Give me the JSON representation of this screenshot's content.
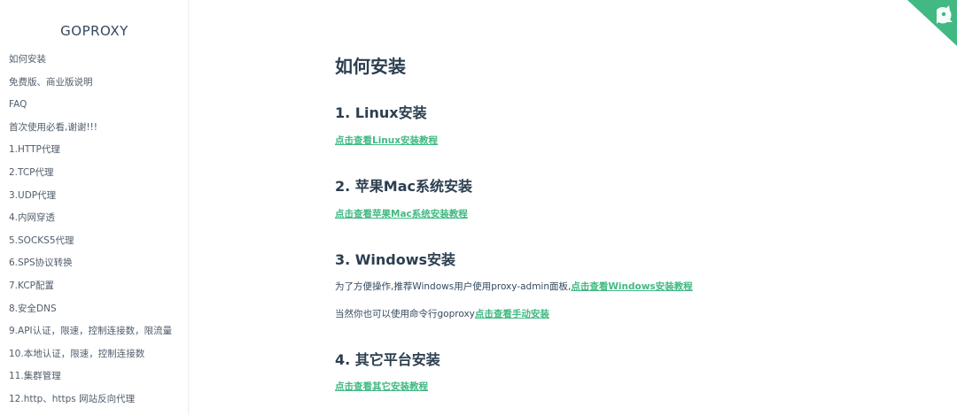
{
  "sidebar": {
    "app_name": "GOPROXY",
    "items": [
      {
        "label": "如何安装"
      },
      {
        "label": "免费版、商业版说明"
      },
      {
        "label": "FAQ"
      },
      {
        "label": "首次使用必看,谢谢!!!"
      },
      {
        "label": "1.HTTP代理"
      },
      {
        "label": "2.TCP代理"
      },
      {
        "label": "3.UDP代理"
      },
      {
        "label": "4.内网穿透"
      },
      {
        "label": "5.SOCKS5代理"
      },
      {
        "label": "6.SPS协议转换"
      },
      {
        "label": "7.KCP配置"
      },
      {
        "label": "8.安全DNS"
      },
      {
        "label": "9.API认证，限速，控制连接数，限流量"
      },
      {
        "label": "10.本地认证，限速，控制连接数"
      },
      {
        "label": "11.集群管理"
      },
      {
        "label": "12.http、https 网站反向代理"
      }
    ]
  },
  "main": {
    "title": "如何安装",
    "sections": [
      {
        "heading": "1. Linux安装",
        "link": "点击查看Linux安装教程"
      },
      {
        "heading": "2. 苹果Mac系统安装",
        "link": "点击查看苹果Mac系统安装教程"
      },
      {
        "heading": "3. Windows安装",
        "line1_text": "为了方便操作,推荐Windows用户使用proxy-admin面板,",
        "line1_link": "点击查看Windows安装教程",
        "line2_text": "当然你也可以使用命令行goproxy",
        "line2_link": "点击查看手动安装"
      },
      {
        "heading": "4. 其它平台安装",
        "link": "点击查看其它安装教程"
      }
    ]
  },
  "colors": {
    "accent": "#42b983",
    "heading": "#2c3e50",
    "text": "#34495e"
  },
  "icons": {
    "corner": "github-corner-icon"
  }
}
